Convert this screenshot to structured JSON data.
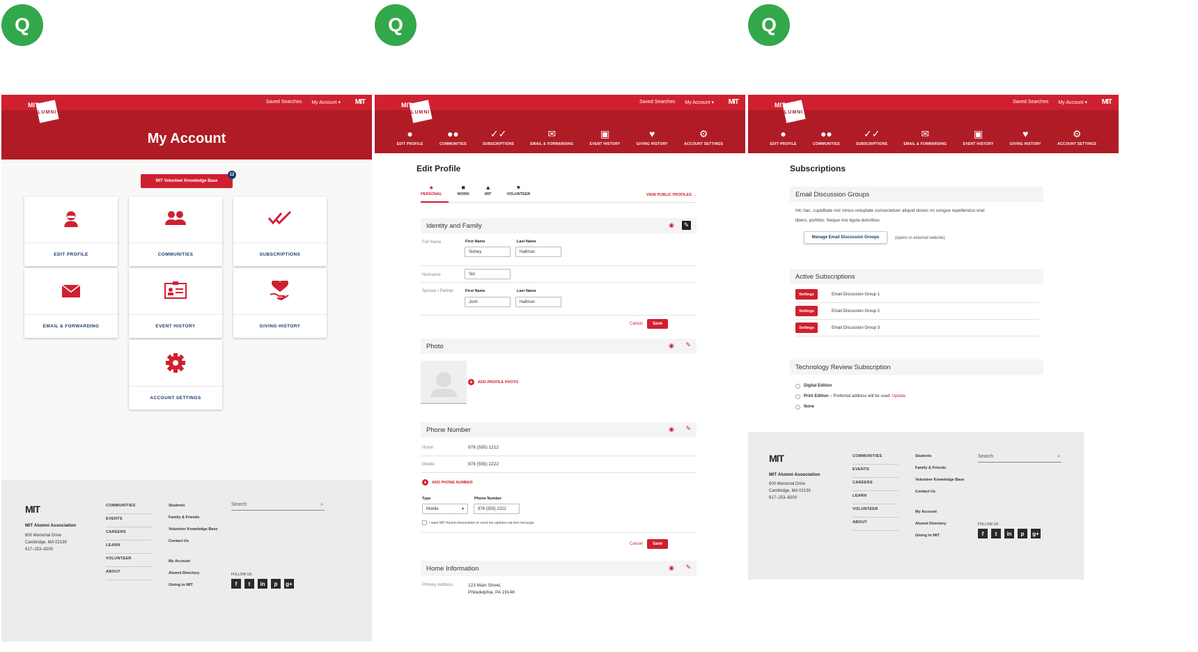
{
  "badge_letter": "Q",
  "logo": {
    "mit": "MIT",
    "alumni": "ALUMNI"
  },
  "header": {
    "saved_searches": "Saved Searches",
    "my_account": "My Account ▾",
    "mit_mark": "MIT"
  },
  "nav": [
    {
      "label": "EDIT PROFILE",
      "icon": "person-icon"
    },
    {
      "label": "COMMUNITIES",
      "icon": "people-icon"
    },
    {
      "label": "SUBSCRIPTIONS",
      "icon": "double-check-icon"
    },
    {
      "label": "EMAIL & FORWARDING",
      "icon": "envelope-icon"
    },
    {
      "label": "EVENT HISTORY",
      "icon": "id-card-icon"
    },
    {
      "label": "GIVING HISTORY",
      "icon": "heart-hand-icon"
    },
    {
      "label": "ACCOUNT SETTINGS",
      "icon": "gear-icon"
    }
  ],
  "account": {
    "title": "My Account",
    "vkb_button": "MIT Volunteer Knowledge Base",
    "vkb_count": "12",
    "tiles": [
      "EDIT PROFILE",
      "COMMUNITIES",
      "SUBSCRIPTIONS",
      "EMAIL & FORWARDING",
      "EVENT HISTORY",
      "GIVING HISTORY",
      "ACCOUNT SETTINGS"
    ]
  },
  "footer": {
    "mit": "MIT",
    "org": "MIT Alumni Association",
    "addr1": "600 Memorial Drive",
    "addr2": "Cambridge, MA 02139",
    "phone": "617–253–8200",
    "col1": [
      "COMMUNITIES",
      "EVENTS",
      "CAREERS",
      "LEARN",
      "VOLUNTEER",
      "ABOUT"
    ],
    "col2a": [
      "Students",
      "Family & Friends",
      "Volunteer Knowledge Base",
      "Contact Us"
    ],
    "col2b": [
      "My Account",
      "Alumni Directory",
      "Giving to MIT"
    ],
    "search_placeholder": "Search",
    "follow": "FOLLOW US",
    "social": [
      "f",
      "t",
      "in",
      "p",
      "g+"
    ]
  },
  "profile": {
    "title": "Edit Profile",
    "subtabs": [
      "PERSONAL",
      "WORK",
      "MIT",
      "VOLUNTEER"
    ],
    "view_public": "VIEW PUBLIC PROFILES →",
    "identity": {
      "title": "Identity and Family",
      "full_name": "Full Name",
      "first_name": "First Name",
      "last_name": "Last Name",
      "first": "Sidney",
      "last": "Hallman",
      "nickname_label": "Nickname",
      "nickname": "Sid",
      "spouse_label": "Spouse / Partner",
      "spouse_first": "Josh",
      "spouse_last": "Hallman"
    },
    "cancel": "Cancel",
    "save": "Save",
    "photo": {
      "title": "Photo",
      "add": "ADD PROFILE PHOTO"
    },
    "phone": {
      "title": "Phone Number",
      "home_label": "Home",
      "home": "978 (555) 1212",
      "mobile_label": "Mobile",
      "mobile": "978 (555) 2222",
      "add": "ADD PHONE NUMBER",
      "type_label": "Type",
      "type_value": "Mobile",
      "number_label": "Phone Number",
      "number_value": "978 (555) 2222",
      "consent": "I want MIT Alumni Association to send me updates via text message."
    },
    "home": {
      "title": "Home Information",
      "addr_label": "Primary Address",
      "addr1": "123 Main Street,",
      "addr2": "Philadelphia, PA 19148"
    }
  },
  "subs": {
    "title": "Subscriptions",
    "email_groups": {
      "title": "Email Discussion Groups",
      "desc1": "Hic hac, cupiditate nisl minus voluptate consectetuer aliquid donec mi congue repellendus erat",
      "desc2": "libero, porttitor. Neque nisi ligula doloribus.",
      "button": "Manage Email Discussion Groups",
      "note": "(opens in external website)"
    },
    "active": {
      "title": "Active Subscriptions",
      "settings": "Settings",
      "items": [
        "Email Discussion Group 1",
        "Email Discussion Group 2",
        "Email Discussion Group 3"
      ]
    },
    "tech": {
      "title": "Technology Review Subscription",
      "digital": "Digital Edition",
      "print": "Print Edition",
      "print_note": " – Preferred address will be used.",
      "update": "Update",
      "none": "None"
    }
  }
}
